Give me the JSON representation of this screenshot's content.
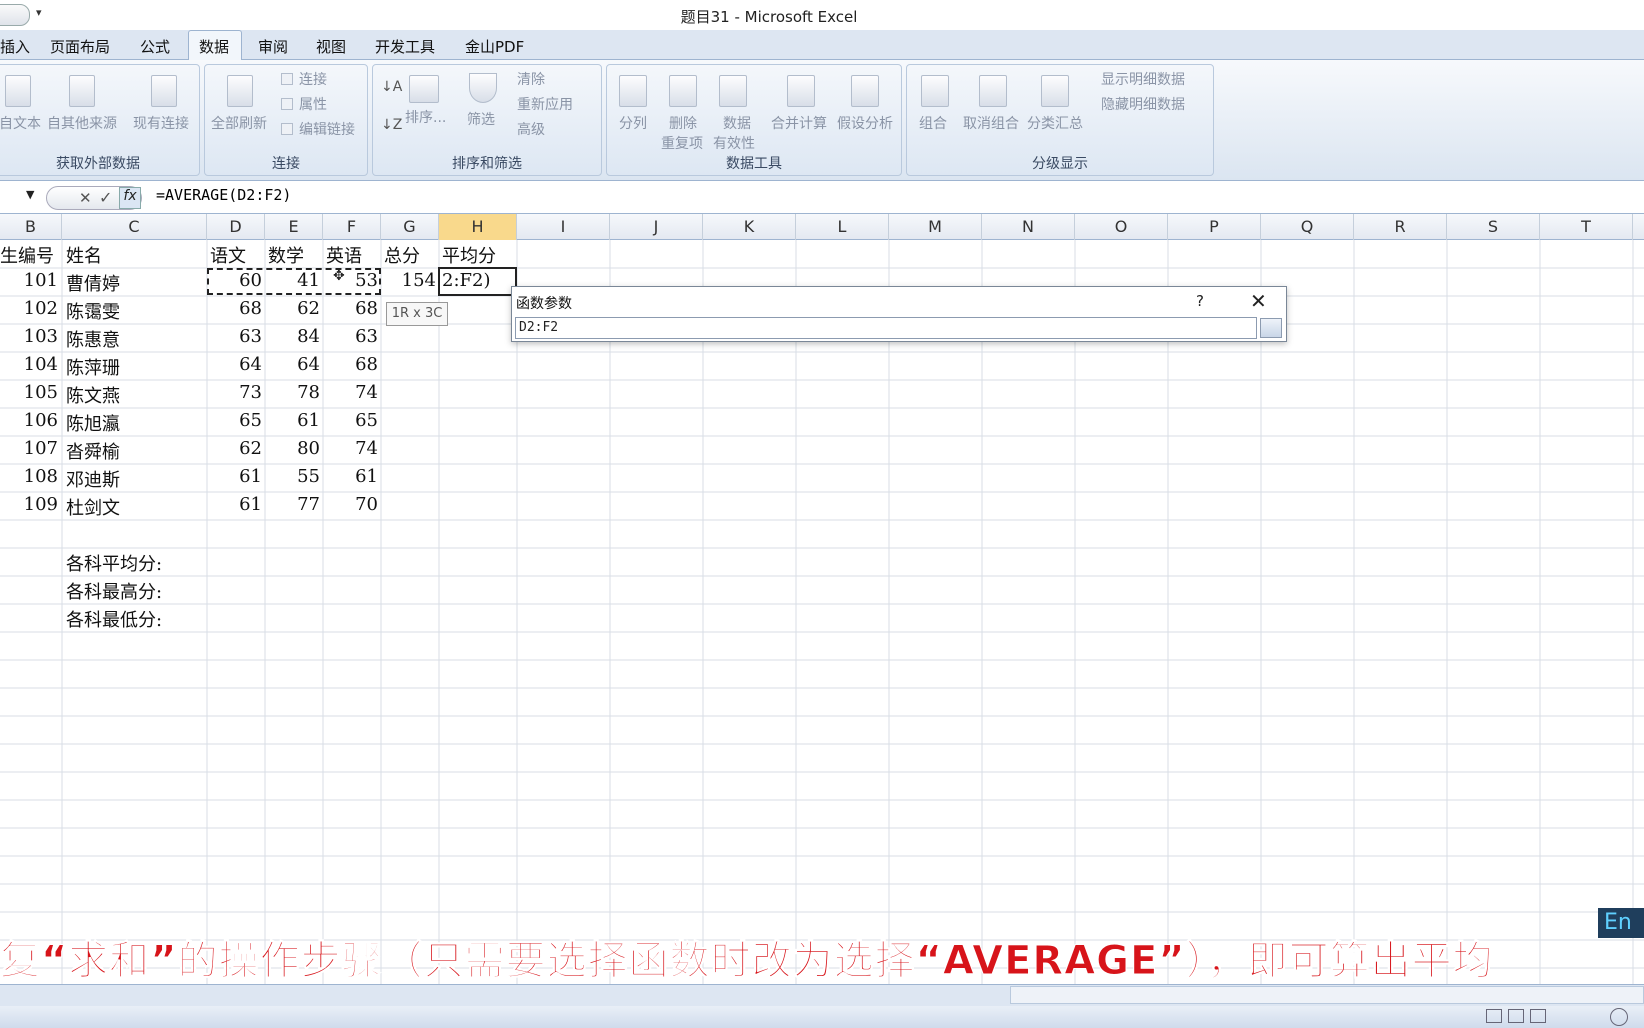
{
  "window": {
    "title": "题目31 - Microsoft Excel"
  },
  "tabs": [
    "插入",
    "页面布局",
    "公式",
    "数据",
    "审阅",
    "视图",
    "开发工具",
    "金山PDF"
  ],
  "ribbon": {
    "get_external": {
      "label": "获取外部数据",
      "from_text": "自文本",
      "from_other": "自其他来源",
      "existing": "现有连接"
    },
    "connections": {
      "label": "连接",
      "refresh_all": "全部刷新",
      "connections": "连接",
      "properties": "属性",
      "edit_links": "编辑链接"
    },
    "sort_filter": {
      "label": "排序和筛选",
      "sort": "排序...",
      "filter": "筛选",
      "clear": "清除",
      "reapply": "重新应用",
      "advanced": "高级"
    },
    "data_tools": {
      "label": "数据工具",
      "text_to_cols": "分列",
      "remove_dup_1": "删除",
      "remove_dup_2": "重复项",
      "validation_1": "数据",
      "validation_2": "有效性",
      "consolidate": "合并计算",
      "what_if": "假设分析"
    },
    "outline": {
      "label": "分级显示",
      "group": "组合",
      "ungroup": "取消组合",
      "subtotal": "分类汇总",
      "show_detail": "显示明细数据",
      "hide_detail": "隐藏明细数据"
    }
  },
  "formula_bar": {
    "formula": "=AVERAGE(D2:F2)"
  },
  "columns": [
    "B",
    "C",
    "D",
    "E",
    "F",
    "G",
    "H",
    "I",
    "J",
    "K",
    "L",
    "M",
    "N",
    "O",
    "P",
    "Q",
    "R",
    "S",
    "T"
  ],
  "headers": {
    "id": "生编号",
    "name": "姓名",
    "chinese": "语文",
    "math": "数学",
    "english": "英语",
    "total": "总分",
    "avg": "平均分"
  },
  "rows": [
    {
      "id": "101",
      "name": "曹倩婷",
      "d": "60",
      "e": "41",
      "f": "53",
      "g": "154",
      "h": "2:F2)"
    },
    {
      "id": "102",
      "name": "陈霭雯",
      "d": "68",
      "e": "62",
      "f": "68",
      "g": "",
      "h": ""
    },
    {
      "id": "103",
      "name": "陈惠意",
      "d": "63",
      "e": "84",
      "f": "63",
      "g": "",
      "h": ""
    },
    {
      "id": "104",
      "name": "陈萍珊",
      "d": "64",
      "e": "64",
      "f": "68",
      "g": "",
      "h": ""
    },
    {
      "id": "105",
      "name": "陈文燕",
      "d": "73",
      "e": "78",
      "f": "74",
      "g": "",
      "h": ""
    },
    {
      "id": "106",
      "name": "陈旭瀛",
      "d": "65",
      "e": "61",
      "f": "65",
      "g": "",
      "h": ""
    },
    {
      "id": "107",
      "name": "沓舜榆",
      "d": "62",
      "e": "80",
      "f": "74",
      "g": "",
      "h": ""
    },
    {
      "id": "108",
      "name": "邓迪斯",
      "d": "61",
      "e": "55",
      "f": "61",
      "g": "",
      "h": ""
    },
    {
      "id": "109",
      "name": "杜剑文",
      "d": "61",
      "e": "77",
      "f": "70",
      "g": "",
      "h": ""
    }
  ],
  "summary": {
    "avg": "各科平均分:",
    "max": "各科最高分:",
    "min": "各科最低分:"
  },
  "tooltip": "1R x 3C",
  "dialog": {
    "title": "函数参数",
    "help": "?",
    "input": "D2:F2"
  },
  "subtitle": "复“求和”的操作步骤（只需要选择函数时改为选择“AVERAGE”），即可算出平均",
  "ime": "En"
}
